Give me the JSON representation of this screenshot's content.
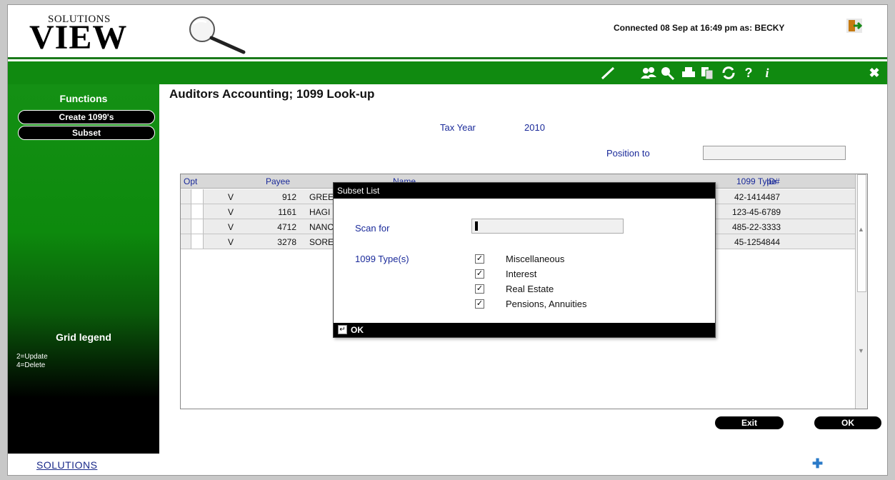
{
  "header": {
    "logo_small": "SOLUTIONS",
    "logo_big": "VIEW",
    "connection": "Connected 08 Sep at 16:49 pm as: BECKY"
  },
  "toolbar": {
    "icons": [
      "brush-icon",
      "users-icon",
      "search-icon",
      "printer-icon",
      "copy-icon",
      "refresh-icon",
      "help-icon",
      "info-icon",
      "close-icon"
    ],
    "help_glyph": "?",
    "info_glyph": "i",
    "close_glyph": "✖"
  },
  "sidebar": {
    "functions_title": "Functions",
    "buttons": [
      "Create 1099's",
      "Subset"
    ],
    "legend_title": "Grid legend",
    "legend_items": [
      "2=Update",
      "4=Delete"
    ]
  },
  "main": {
    "title": "Auditors Accounting; 1099 Look-up",
    "tax_year_label": "Tax Year",
    "tax_year_value": "2010",
    "position_label": "Position to",
    "position_value": ""
  },
  "grid": {
    "headers": [
      "Opt",
      "Payee",
      "Name",
      "1099 Type",
      "ID#"
    ],
    "rows": [
      {
        "type": "V",
        "payee": "912",
        "name": "GREE",
        "id": "42-1414487"
      },
      {
        "type": "V",
        "payee": "1161",
        "name": "HAGI",
        "id": "123-45-6789"
      },
      {
        "type": "V",
        "payee": "4712",
        "name": "NANC",
        "id": "485-22-3333"
      },
      {
        "type": "V",
        "payee": "3278",
        "name": "SORE",
        "id": "45-1254844"
      }
    ]
  },
  "dialog": {
    "title": "Subset List",
    "scan_label": "Scan for",
    "scan_value": "",
    "types_label": "1099 Type(s)",
    "types": [
      {
        "label": "Miscellaneous",
        "checked": true
      },
      {
        "label": "Interest",
        "checked": true
      },
      {
        "label": "Real Estate",
        "checked": true
      },
      {
        "label": "Pensions, Annuities",
        "checked": true
      }
    ],
    "ok_label": "OK"
  },
  "buttons": {
    "exit": "Exit",
    "ok": "OK"
  },
  "footer": {
    "logo": "SOLUTIONS",
    "plus_glyph": "✚"
  },
  "colors": {
    "green": "#108a10",
    "label_blue": "#1a2a9a"
  }
}
